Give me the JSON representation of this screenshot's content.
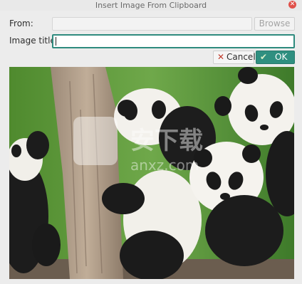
{
  "window": {
    "title": "Insert Image From Clipboard",
    "close_icon": "close-icon"
  },
  "form": {
    "from_label": "From:",
    "from_value": "",
    "browse_label": "Browse",
    "image_title_label": "Image title:",
    "image_title_value": ""
  },
  "buttons": {
    "cancel_label": "Cancel",
    "cancel_icon": "close-x-icon",
    "ok_label": "OK",
    "ok_icon": "check-icon"
  },
  "preview": {
    "content": "pandas-photo",
    "watermark_text": "安下载",
    "watermark_domain": "anxz.com"
  },
  "colors": {
    "accent": "#2f8f80",
    "close": "#e0514a",
    "background": "#ececec"
  }
}
